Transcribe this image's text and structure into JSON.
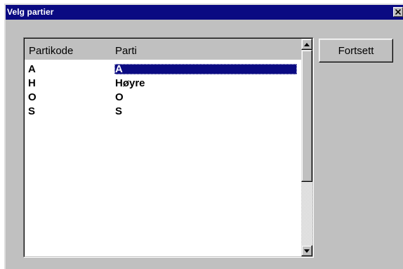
{
  "window": {
    "title": "Velg partier",
    "close_glyph": "✕"
  },
  "list": {
    "columns": [
      "Partikode",
      "Parti"
    ],
    "rows": [
      {
        "code": "A",
        "party": "A",
        "selected": true
      },
      {
        "code": "H",
        "party": "Høyre",
        "selected": false
      },
      {
        "code": "O",
        "party": "O",
        "selected": false
      },
      {
        "code": "S",
        "party": "S",
        "selected": false
      }
    ]
  },
  "buttons": {
    "continue_label": "Fortsett"
  },
  "colors": {
    "titlebar": "#0a0a82",
    "face": "#c0c0c0",
    "selection": "#0a0a82"
  },
  "icons": {
    "close": "close-icon",
    "scroll_up": "arrow-up-icon",
    "scroll_down": "arrow-down-icon"
  }
}
